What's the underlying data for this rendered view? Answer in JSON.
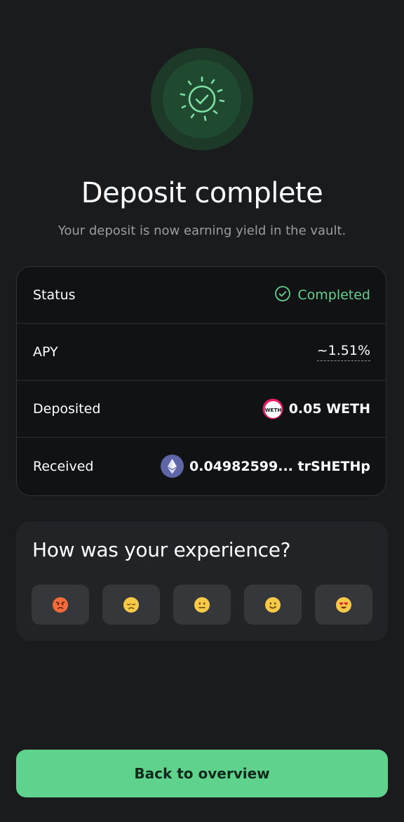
{
  "hero": {
    "icon": "check-circle-burst-icon",
    "title": "Deposit complete",
    "subtitle": "Your deposit is now earning yield in the vault."
  },
  "details": {
    "rows": [
      {
        "label": "Status",
        "value": "Completed",
        "icon": "check-circle-icon"
      },
      {
        "label": "APY",
        "value": "~1.51%"
      },
      {
        "label": "Deposited",
        "value": "0.05 WETH",
        "icon": "weth-token-icon",
        "icon_text": "WETH"
      },
      {
        "label": "Received",
        "value": "0.04982599... trSHETHp",
        "icon": "ethereum-token-icon"
      }
    ]
  },
  "feedback": {
    "title": "How was your experience?",
    "options": [
      {
        "name": "angry",
        "emoji": "😡"
      },
      {
        "name": "sad",
        "emoji": "😞"
      },
      {
        "name": "neutral",
        "emoji": "😐"
      },
      {
        "name": "happy",
        "emoji": "🙂"
      },
      {
        "name": "love",
        "emoji": "😍"
      }
    ]
  },
  "actions": {
    "back_label": "Back to overview"
  },
  "colors": {
    "background": "#1a1b1d",
    "accent": "#5fd38d",
    "success_text": "#64d08e",
    "card": "#111214",
    "feedback_card": "#222326"
  }
}
